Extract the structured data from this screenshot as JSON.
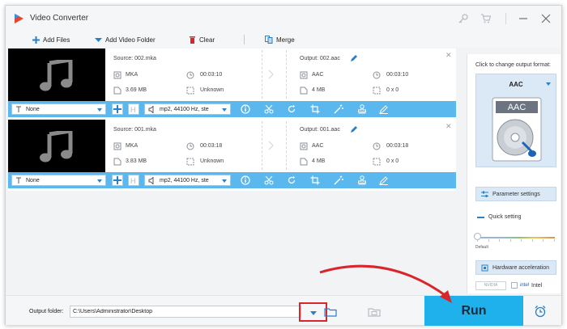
{
  "app": {
    "title": "Video Converter"
  },
  "toolbar": {
    "add_files": "Add Files",
    "add_video_folder": "Add Video Folder",
    "clear": "Clear",
    "merge": "Merge"
  },
  "items": [
    {
      "source_name": "Source: 002.mka",
      "source_format": "MKA",
      "source_duration": "00:03:10",
      "source_size": "3.69 MB",
      "source_resolution": "Unknown",
      "output_name": "Output: 002.aac",
      "output_format": "AAC",
      "output_duration": "00:03:10",
      "output_size": "4 MB",
      "output_resolution": "0 x 0",
      "subtitle": "None",
      "audio_track": "mp2, 44100 Hz, ste"
    },
    {
      "source_name": "Source: 001.mka",
      "source_format": "MKA",
      "source_duration": "00:03:18",
      "source_size": "3.83 MB",
      "source_resolution": "Unknown",
      "output_name": "Output: 001.aac",
      "output_format": "AAC",
      "output_duration": "00:03:18",
      "output_size": "4 MB",
      "output_resolution": "0 x 0",
      "subtitle": "None",
      "audio_track": "mp2, 44100 Hz, ste"
    }
  ],
  "panel": {
    "hint": "Click to change output format:",
    "format": "AAC",
    "format_badge": "AAC",
    "parameter_settings": "Parameter settings",
    "quick_setting": "Quick setting",
    "default_label": "Default",
    "hardware_acceleration": "Hardware acceleration",
    "nvidia": "NVIDIA",
    "intel_logo": "intel",
    "intel": "Intel"
  },
  "bottom": {
    "output_folder_label": "Output folder:",
    "output_path": "C:\\Users\\Administrator\\Desktop",
    "run": "Run"
  },
  "colors": {
    "accent_blue": "#5bb8ee",
    "run_button": "#1fb1ec",
    "highlight_red": "#d9262c",
    "icon_blue": "#2b7fc4"
  },
  "icons": {
    "app": "video-converter-logo-icon",
    "add_files": "plus-icon",
    "add_video_folder": "dropdown-arrow-icon",
    "clear": "trash-icon",
    "merge": "merge-icon",
    "thumbnail": "music-note-icon",
    "edit": "pencil-icon",
    "info": "info-icon",
    "cut": "scissors-icon",
    "rotate": "rotate-icon",
    "crop": "crop-icon",
    "effects": "magic-wand-icon",
    "watermark": "stamp-icon",
    "subtitle_edit": "subtitle-edit-icon",
    "alarm": "alarm-clock-icon",
    "folder": "folder-icon"
  }
}
